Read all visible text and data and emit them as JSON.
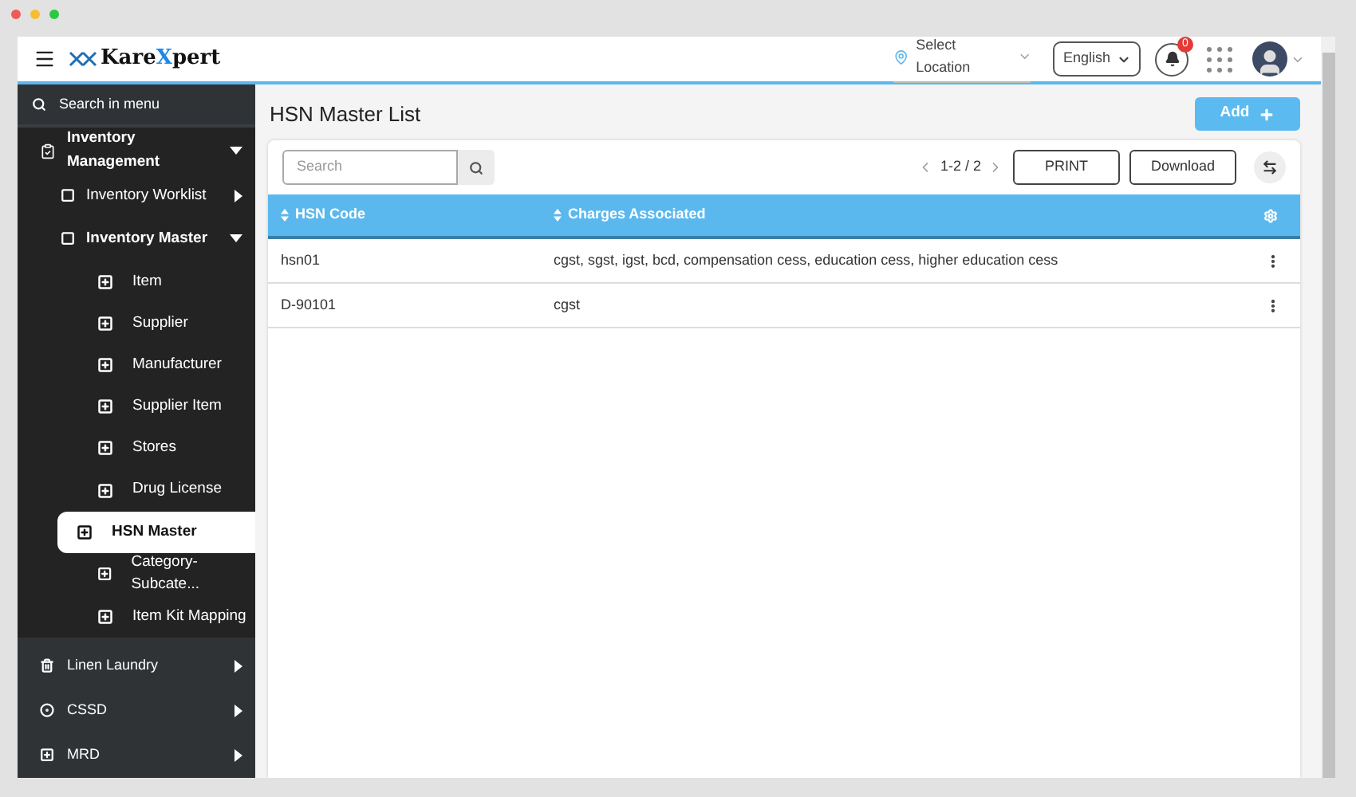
{
  "header": {
    "logo": {
      "prefix": "Kare",
      "accent": "X",
      "suffix": "pert"
    },
    "location": "Select Location",
    "language": "English",
    "notification_count": "0"
  },
  "sidebar": {
    "search_placeholder": "Search in menu",
    "items": [
      {
        "label": "Inventory Management",
        "expanded": true,
        "selected": false,
        "children": [
          {
            "label": "Inventory Worklist",
            "expanded": false,
            "selected": false
          },
          {
            "label": "Inventory Master",
            "expanded": true,
            "selected": false,
            "children": [
              {
                "label": "Item",
                "selected": false
              },
              {
                "label": "Supplier",
                "selected": false
              },
              {
                "label": "Manufacturer",
                "selected": false
              },
              {
                "label": "Supplier Item",
                "selected": false
              },
              {
                "label": "Stores",
                "selected": false
              },
              {
                "label": "Drug License",
                "selected": false
              },
              {
                "label": "HSN Master",
                "selected": true
              },
              {
                "label": "Category-Subcate...",
                "selected": false
              },
              {
                "label": "Item Kit Mapping",
                "selected": false
              }
            ]
          }
        ]
      },
      {
        "label": "Linen Laundry",
        "expanded": false,
        "selected": false
      },
      {
        "label": "CSSD",
        "expanded": false,
        "selected": false
      },
      {
        "label": "MRD",
        "expanded": false,
        "selected": false
      }
    ]
  },
  "page": {
    "title": "HSN Master List",
    "add_button": "Add",
    "search_placeholder": "Search",
    "pagination": "1-2 / 2",
    "print_button": "PRINT",
    "download_button": "Download"
  },
  "table": {
    "columns": [
      "HSN Code",
      "Charges Associated"
    ],
    "rows": [
      {
        "cells": [
          "hsn01",
          "cgst, sgst, igst, bcd, compensation cess, education cess, higher education cess"
        ]
      },
      {
        "cells": [
          "D-90101",
          "cgst"
        ]
      }
    ]
  }
}
